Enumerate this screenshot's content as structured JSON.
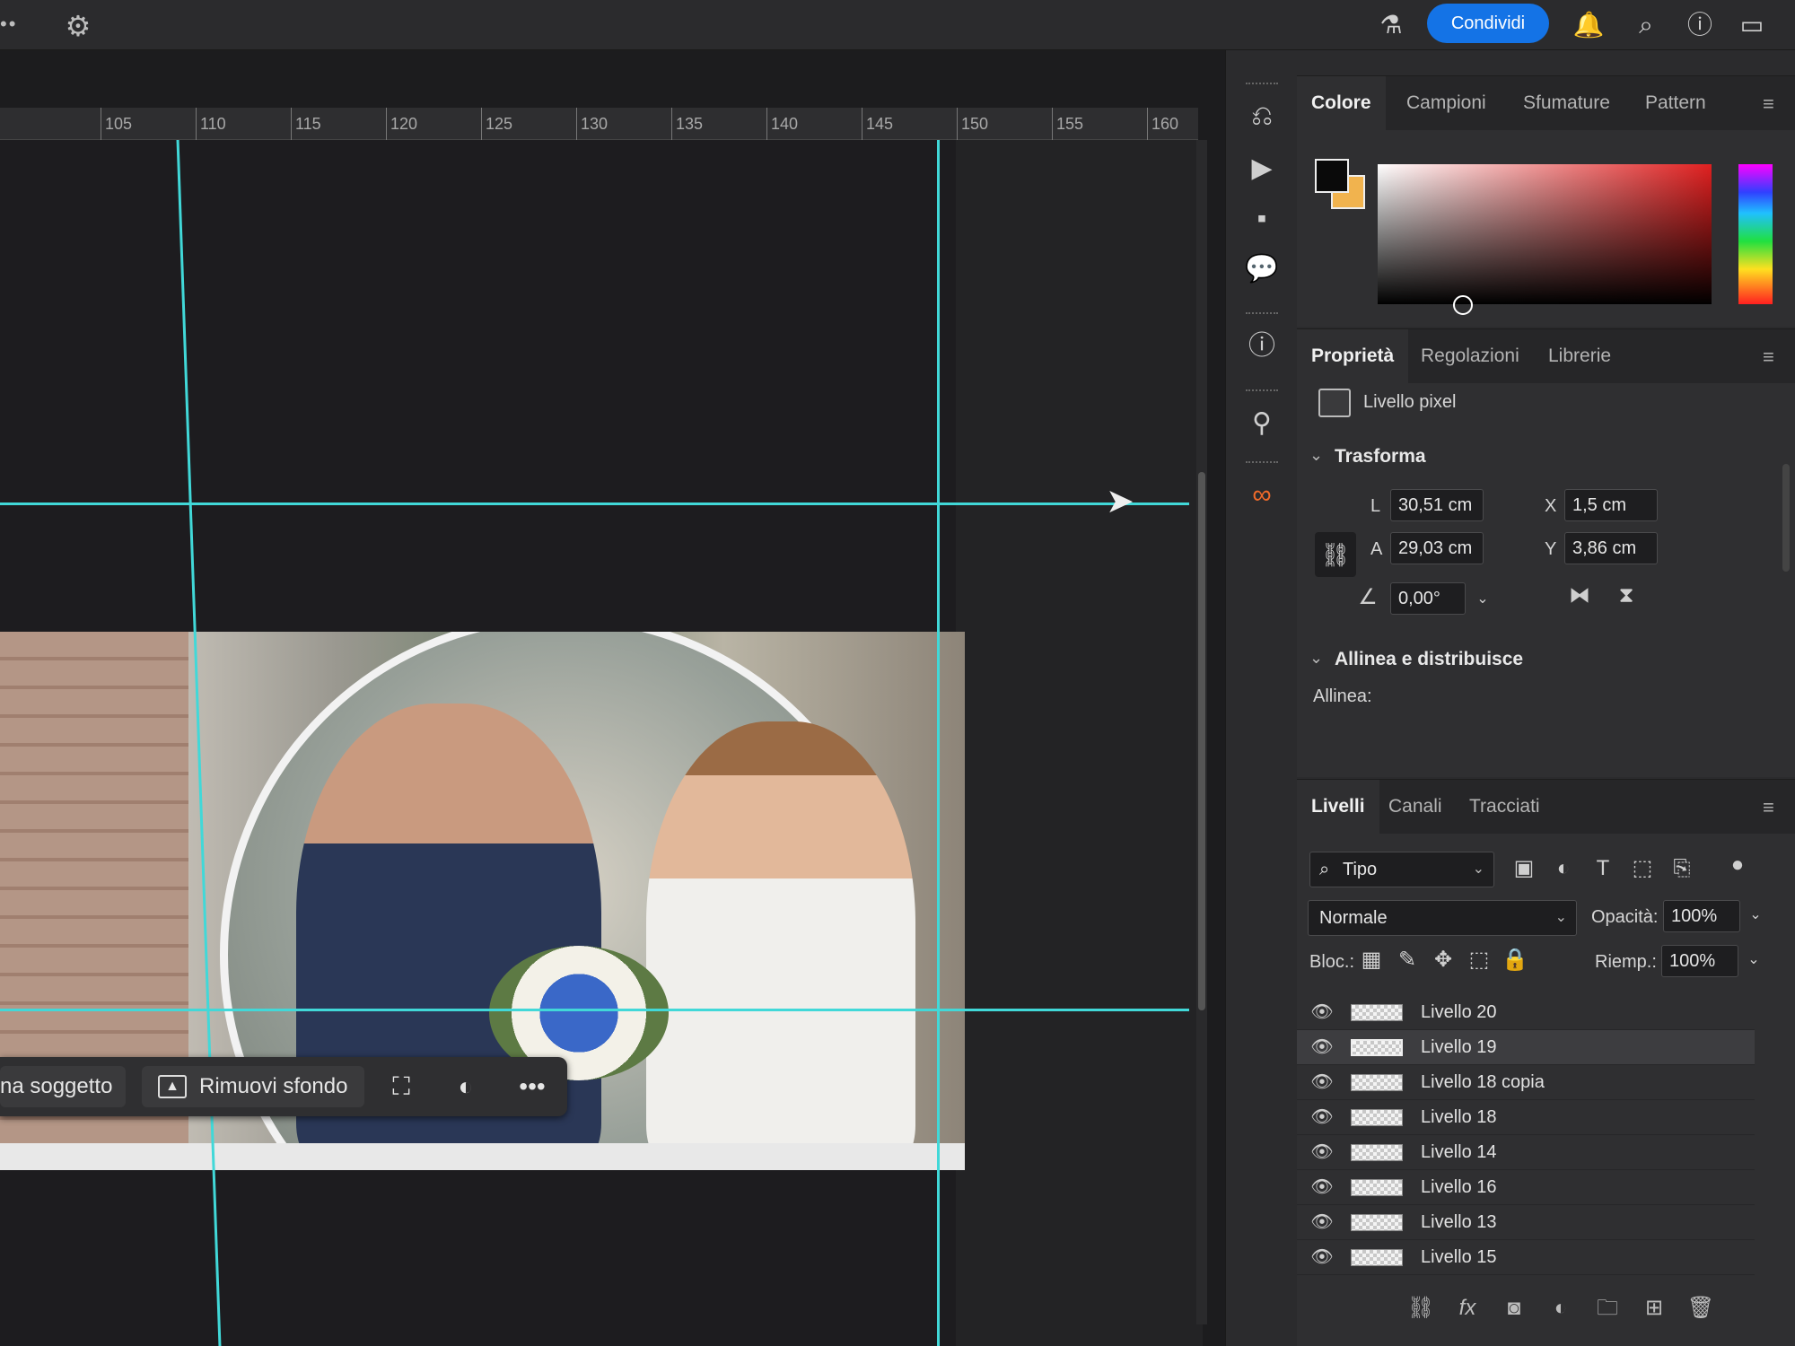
{
  "topbar": {
    "share_label": "Condividi",
    "icons": [
      "gear-icon",
      "flask-icon",
      "bell-icon",
      "search-icon",
      "help-icon",
      "window-icon"
    ]
  },
  "ruler": {
    "labels": [
      "105",
      "110",
      "115",
      "120",
      "125",
      "130",
      "135",
      "140",
      "145",
      "150",
      "155",
      "160"
    ]
  },
  "canvas": {
    "context_bar": {
      "select_subject": "na soggetto",
      "remove_background": "Rimuovi sfondo",
      "more": "•••"
    }
  },
  "color_panel": {
    "tabs": [
      "Colore",
      "Campioni",
      "Sfumature",
      "Pattern"
    ],
    "active_tab": "Colore",
    "foreground_color": "#0a0a0a",
    "background_color": "#f1b34e"
  },
  "properties_panel": {
    "tabs": [
      "Proprietà",
      "Regolazioni",
      "Librerie"
    ],
    "layer_type": "Livello pixel",
    "transform": {
      "title": "Trasforma",
      "width_label": "L",
      "width": "30,51 cm",
      "height_label": "A",
      "height": "29,03 cm",
      "x_label": "X",
      "x": "1,5 cm",
      "y_label": "Y",
      "y": "3,86 cm",
      "angle": "0,00°"
    },
    "align": {
      "title": "Allinea e distribuisce",
      "label": "Allinea:"
    }
  },
  "layers_panel": {
    "tabs": [
      "Livelli",
      "Canali",
      "Tracciati"
    ],
    "filter": "Tipo",
    "blend_mode": "Normale",
    "opacity_label": "Opacità:",
    "opacity": "100%",
    "lock_label": "Bloc.:",
    "fill_label": "Riemp.:",
    "fill": "100%",
    "layers": [
      {
        "name": "Livello 20",
        "selected": false
      },
      {
        "name": "Livello 19",
        "selected": true
      },
      {
        "name": "Livello 18 copia",
        "selected": false
      },
      {
        "name": "Livello 18",
        "selected": false
      },
      {
        "name": "Livello 14",
        "selected": false
      },
      {
        "name": "Livello 16",
        "selected": false
      },
      {
        "name": "Livello 13",
        "selected": false
      },
      {
        "name": "Livello 15",
        "selected": false
      }
    ]
  }
}
